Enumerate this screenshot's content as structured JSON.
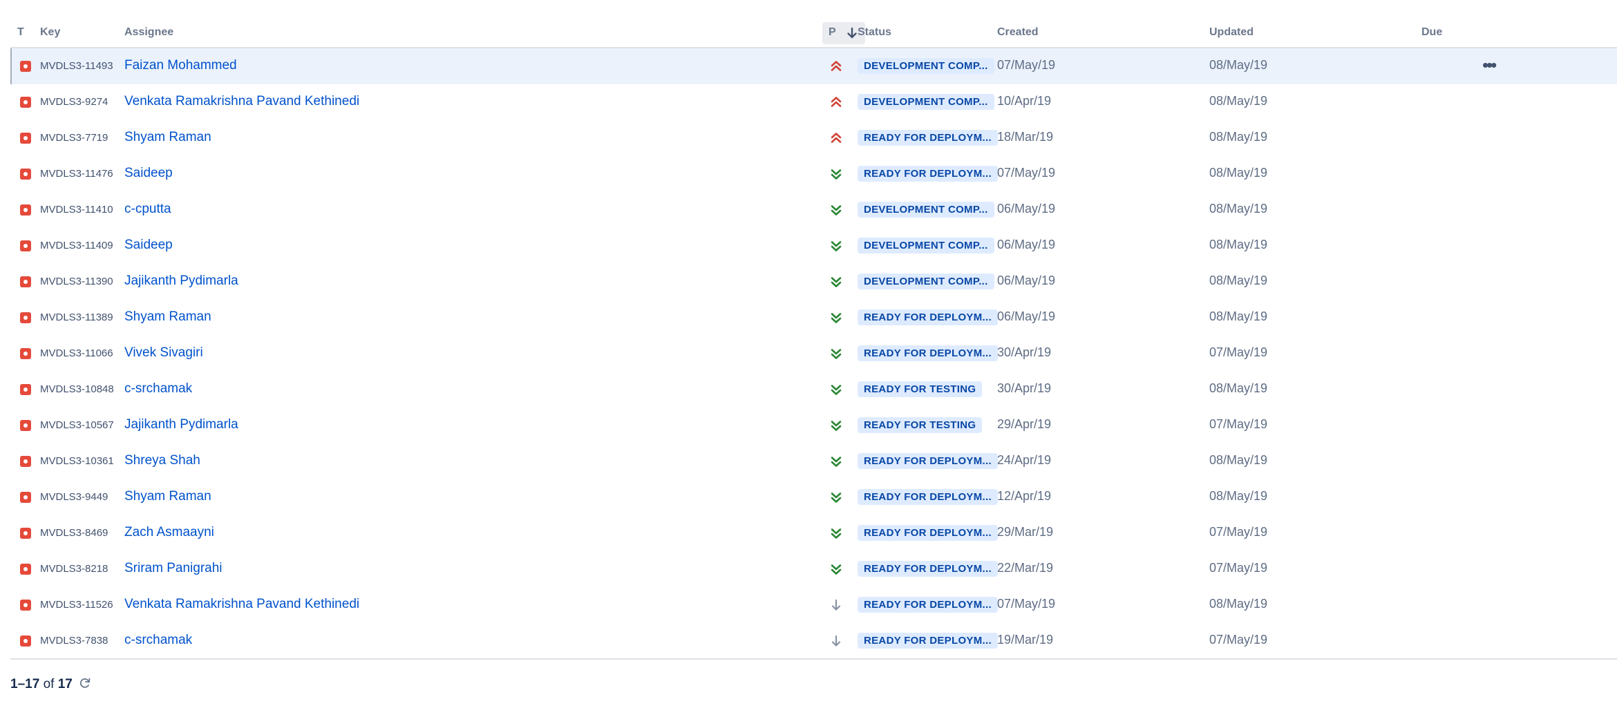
{
  "columns": {
    "type": "T",
    "key": "Key",
    "assignee": "Assignee",
    "priority": "P",
    "status": "Status",
    "created": "Created",
    "updated": "Updated",
    "due": "Due"
  },
  "colors": {
    "bug": "#e5493a",
    "highest": "#d04437",
    "lowest": "#2a8735",
    "low": "#8993a4",
    "link": "#0052cc",
    "lozenge_bg": "#deebff",
    "lozenge_text": "#0747a6"
  },
  "rows": [
    {
      "key": "MVDLS3-11493",
      "assignee": "Faizan Mohammed",
      "priority": "highest-icon",
      "status": "DEVELOPMENT COMP...",
      "created": "07/May/19",
      "updated": "08/May/19"
    },
    {
      "key": "MVDLS3-9274",
      "assignee": "Venkata Ramakrishna Pavand Kethinedi",
      "priority": "highest-icon",
      "status": "DEVELOPMENT COMP...",
      "created": "10/Apr/19",
      "updated": "08/May/19"
    },
    {
      "key": "MVDLS3-7719",
      "assignee": "Shyam Raman",
      "priority": "highest-icon",
      "status": "READY FOR DEPLOYM...",
      "created": "18/Mar/19",
      "updated": "08/May/19"
    },
    {
      "key": "MVDLS3-11476",
      "assignee": "Saideep",
      "priority": "lowest-icon",
      "status": "READY FOR DEPLOYM...",
      "created": "07/May/19",
      "updated": "08/May/19"
    },
    {
      "key": "MVDLS3-11410",
      "assignee": "c-cputta",
      "priority": "lowest-icon",
      "status": "DEVELOPMENT COMP...",
      "created": "06/May/19",
      "updated": "08/May/19"
    },
    {
      "key": "MVDLS3-11409",
      "assignee": "Saideep",
      "priority": "lowest-icon",
      "status": "DEVELOPMENT COMP...",
      "created": "06/May/19",
      "updated": "08/May/19"
    },
    {
      "key": "MVDLS3-11390",
      "assignee": "Jajikanth Pydimarla",
      "priority": "lowest-icon",
      "status": "DEVELOPMENT COMP...",
      "created": "06/May/19",
      "updated": "08/May/19"
    },
    {
      "key": "MVDLS3-11389",
      "assignee": "Shyam Raman",
      "priority": "lowest-icon",
      "status": "READY FOR DEPLOYM...",
      "created": "06/May/19",
      "updated": "08/May/19"
    },
    {
      "key": "MVDLS3-11066",
      "assignee": "Vivek Sivagiri",
      "priority": "lowest-icon",
      "status": "READY FOR DEPLOYM...",
      "created": "30/Apr/19",
      "updated": "07/May/19"
    },
    {
      "key": "MVDLS3-10848",
      "assignee": "c-srchamak",
      "priority": "lowest-icon",
      "status": "READY FOR TESTING",
      "created": "30/Apr/19",
      "updated": "08/May/19"
    },
    {
      "key": "MVDLS3-10567",
      "assignee": "Jajikanth Pydimarla",
      "priority": "lowest-icon",
      "status": "READY FOR TESTING",
      "created": "29/Apr/19",
      "updated": "07/May/19"
    },
    {
      "key": "MVDLS3-10361",
      "assignee": "Shreya Shah",
      "priority": "lowest-icon",
      "status": "READY FOR DEPLOYM...",
      "created": "24/Apr/19",
      "updated": "08/May/19"
    },
    {
      "key": "MVDLS3-9449",
      "assignee": "Shyam Raman",
      "priority": "lowest-icon",
      "status": "READY FOR DEPLOYM...",
      "created": "12/Apr/19",
      "updated": "08/May/19"
    },
    {
      "key": "MVDLS3-8469",
      "assignee": "Zach Asmaayni",
      "priority": "lowest-icon",
      "status": "READY FOR DEPLOYM...",
      "created": "29/Mar/19",
      "updated": "07/May/19"
    },
    {
      "key": "MVDLS3-8218",
      "assignee": "Sriram Panigrahi",
      "priority": "lowest-icon",
      "status": "READY FOR DEPLOYM...",
      "created": "22/Mar/19",
      "updated": "07/May/19"
    },
    {
      "key": "MVDLS3-11526",
      "assignee": "Venkata Ramakrishna Pavand Kethinedi",
      "priority": "low-icon",
      "status": "READY FOR DEPLOYM...",
      "created": "07/May/19",
      "updated": "08/May/19"
    },
    {
      "key": "MVDLS3-7838",
      "assignee": "c-srchamak",
      "priority": "low-icon",
      "status": "READY FOR DEPLOYM...",
      "created": "19/Mar/19",
      "updated": "07/May/19"
    }
  ],
  "pagination": {
    "range": "1–17",
    "of": "of",
    "total": "17"
  }
}
